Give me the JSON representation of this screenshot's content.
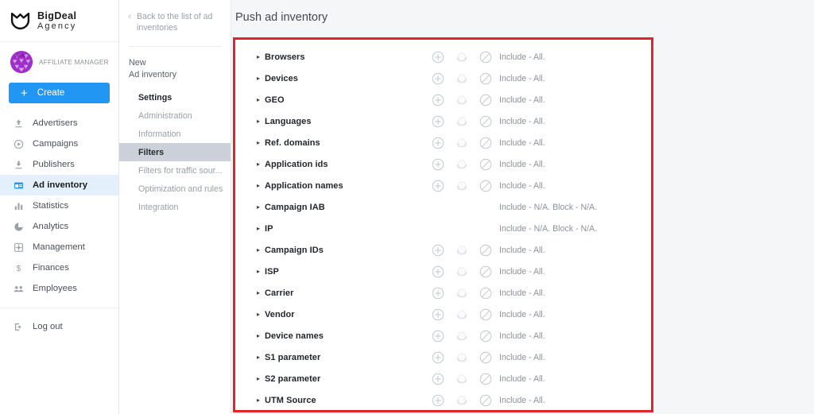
{
  "brand": {
    "logo_icon": "shield-logo-icon",
    "line1": "BigDeal",
    "line2": "Agency"
  },
  "account": {
    "avatar_icon": "user-avatar-icon",
    "role_label": "AFFILIATE MANAGER",
    "avatar_color": "#8b23b5"
  },
  "create_button": {
    "label": "Create",
    "icon": "plus-icon",
    "color": "#2196f3"
  },
  "sidebar": {
    "items": [
      {
        "label": "Advertisers",
        "icon": "upload-arrow-icon",
        "active": false
      },
      {
        "label": "Campaigns",
        "icon": "play-circle-icon",
        "active": false
      },
      {
        "label": "Publishers",
        "icon": "download-arrow-icon",
        "active": false
      },
      {
        "label": "Ad inventory",
        "icon": "window-icon",
        "active": true
      },
      {
        "label": "Statistics",
        "icon": "bar-chart-icon",
        "active": false
      },
      {
        "label": "Analytics",
        "icon": "pie-chart-icon",
        "active": false
      },
      {
        "label": "Management",
        "icon": "settings-square-icon",
        "active": false
      },
      {
        "label": "Finances",
        "icon": "dollar-icon",
        "active": false
      },
      {
        "label": "Employees",
        "icon": "people-icon",
        "active": false
      }
    ],
    "logout": {
      "label": "Log out",
      "icon": "logout-icon"
    }
  },
  "subnav": {
    "back_label": "Back to the list of ad inventories",
    "back_icon": "chevron-left-icon",
    "title_line1": "New",
    "title_line2": "Ad inventory",
    "items": [
      {
        "label": "Settings",
        "style": "head"
      },
      {
        "label": "Administration",
        "style": "normal"
      },
      {
        "label": "Information",
        "style": "normal"
      },
      {
        "label": "Filters",
        "style": "active"
      },
      {
        "label": "Filters for traffic sour...",
        "style": "normal"
      },
      {
        "label": "Optimization and rules",
        "style": "normal"
      },
      {
        "label": "Integration",
        "style": "normal"
      }
    ]
  },
  "main": {
    "page_title": "Push ad inventory",
    "highlight_color": "#e8222a",
    "row_icons": {
      "add": "plus-circle-icon",
      "toggle": "filled-circle-icon",
      "block": "block-circle-icon"
    },
    "rows": [
      {
        "name": "Browsers",
        "status": "Include - All.",
        "has_icons": true
      },
      {
        "name": "Devices",
        "status": "Include - All.",
        "has_icons": true
      },
      {
        "name": "GEO",
        "status": "Include - All.",
        "has_icons": true
      },
      {
        "name": "Languages",
        "status": "Include - All.",
        "has_icons": true
      },
      {
        "name": "Ref. domains",
        "status": "Include - All.",
        "has_icons": true
      },
      {
        "name": "Application ids",
        "status": "Include - All.",
        "has_icons": true
      },
      {
        "name": "Application names",
        "status": "Include - All.",
        "has_icons": true
      },
      {
        "name": "Campaign IAB",
        "status": "Include - N/A. Block - N/A.",
        "has_icons": false
      },
      {
        "name": "IP",
        "status": "Include - N/A. Block - N/A.",
        "has_icons": false
      },
      {
        "name": "Campaign IDs",
        "status": "Include - All.",
        "has_icons": true
      },
      {
        "name": "ISP",
        "status": "Include - All.",
        "has_icons": true
      },
      {
        "name": "Carrier",
        "status": "Include - All.",
        "has_icons": true
      },
      {
        "name": "Vendor",
        "status": "Include - All.",
        "has_icons": true
      },
      {
        "name": "Device names",
        "status": "Include - All.",
        "has_icons": true
      },
      {
        "name": "S1 parameter",
        "status": "Include - All.",
        "has_icons": true
      },
      {
        "name": "S2 parameter",
        "status": "Include - All.",
        "has_icons": true
      },
      {
        "name": "UTM Source",
        "status": "Include - All.",
        "has_icons": true
      }
    ],
    "caret_glyph": "▸"
  }
}
